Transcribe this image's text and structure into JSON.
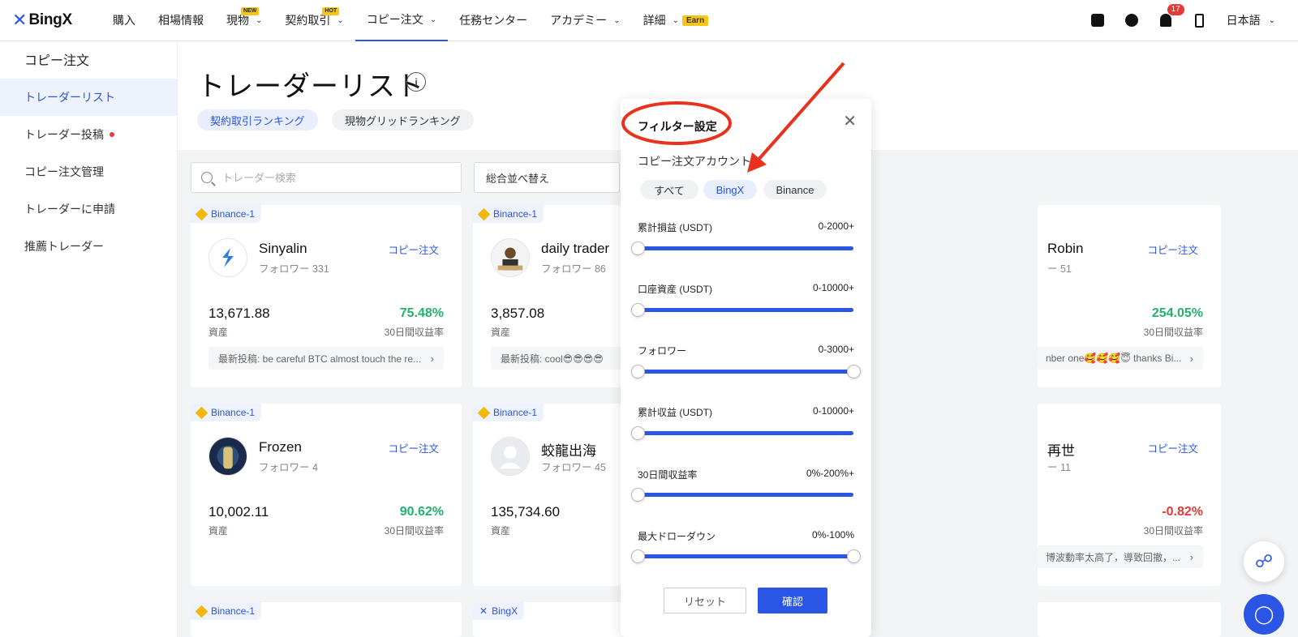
{
  "brand": {
    "name": "BingX",
    "color": "#2a55e5"
  },
  "nav": {
    "items": [
      {
        "label": "購入",
        "badge": "",
        "chevron": false
      },
      {
        "label": "相場情報",
        "badge": "",
        "chevron": false
      },
      {
        "label": "現物",
        "badge": "NEW",
        "chevron": true
      },
      {
        "label": "契約取引",
        "badge": "HOT",
        "chevron": true
      },
      {
        "label": "コピー注文",
        "badge": "",
        "chevron": true,
        "active": true
      },
      {
        "label": "任務センター",
        "badge": "",
        "chevron": false
      },
      {
        "label": "アカデミー",
        "badge": "",
        "chevron": true
      },
      {
        "label": "詳細",
        "badge": "",
        "chevron": true,
        "extra": "Earn"
      }
    ],
    "notification_count": "17",
    "language": "日本語"
  },
  "sidebar": {
    "title": "コピー注文",
    "items": [
      {
        "label": "トレーダーリスト",
        "active": true
      },
      {
        "label": "トレーダー投稿",
        "dot": true
      },
      {
        "label": "コピー注文管理"
      },
      {
        "label": "トレーダーに申請"
      },
      {
        "label": "推薦トレーダー"
      }
    ]
  },
  "page": {
    "title": "トレーダーリスト",
    "info_icon": "i",
    "tabs": [
      "契約取引ランキング",
      "現物グリッドランキング"
    ],
    "search_placeholder": "トレーダー検索",
    "sort_label": "総合並べ替え"
  },
  "cards": [
    {
      "source": "Binance-1",
      "source_icon": "binance",
      "name": "Sinyalin",
      "followers": "フォロワー 331",
      "copy": "コピー注文",
      "assets": "13,671.88",
      "assets_label": "資産",
      "roi": "75.48%",
      "roi_sign": "pos",
      "roi_label": "30日間収益率",
      "post": "最新投稿: be careful BTC almost touch the re..."
    },
    {
      "source": "Binance-1",
      "source_icon": "binance",
      "name": "daily trader",
      "followers": "フォロワー 86",
      "copy": "",
      "assets": "3,857.08",
      "assets_label": "資産",
      "roi": "",
      "roi_sign": "pos",
      "roi_label": "",
      "post": "最新投稿: cool😎😎😎😎"
    },
    {
      "source": "",
      "source_icon": "",
      "name": "Robin",
      "followers": "ー 51",
      "copy": "コピー注文",
      "assets": "",
      "assets_label": "",
      "roi": "254.05%",
      "roi_sign": "pos",
      "roi_label": "30日間収益率",
      "post": "nber one🥰🥰🥰😇 thanks Bi..."
    },
    {
      "source": "Binance-1",
      "source_icon": "binance",
      "name": "Frozen",
      "followers": "フォロワー 4",
      "copy": "コピー注文",
      "assets": "10,002.11",
      "assets_label": "資産",
      "roi": "90.62%",
      "roi_sign": "pos",
      "roi_label": "30日間収益率",
      "post": ""
    },
    {
      "source": "Binance-1",
      "source_icon": "binance",
      "name": "蛟龍出海",
      "followers": "フォロワー 45",
      "copy": "",
      "assets": "135,734.60",
      "assets_label": "資産",
      "roi": "",
      "roi_sign": "pos",
      "roi_label": "",
      "post": ""
    },
    {
      "source": "",
      "source_icon": "",
      "name": "再世",
      "followers": "ー 11",
      "copy": "コピー注文",
      "assets": "",
      "assets_label": "",
      "roi": "-0.82%",
      "roi_sign": "neg",
      "roi_label": "30日間収益率",
      "post": "博波動率太高了，導致回撤，..."
    },
    {
      "source": "Binance-1",
      "source_icon": "binance"
    },
    {
      "source": "BingX",
      "source_icon": "bingx"
    }
  ],
  "filter": {
    "title": "フィルター設定",
    "subtitle": "コピー注文アカウント",
    "account_tabs": [
      "すべて",
      "BingX",
      "Binance"
    ],
    "active_tab": "BingX",
    "rows": [
      {
        "label": "累計損益 (USDT)",
        "range": "0-2000+",
        "min": 0,
        "max": 0
      },
      {
        "label": "口座資産 (USDT)",
        "range": "0-10000+",
        "min": 0,
        "max": 0
      },
      {
        "label": "フォロワー",
        "range": "0-3000+",
        "min": 0,
        "max": 1
      },
      {
        "label": "累計収益 (USDT)",
        "range": "0-10000+",
        "min": 0,
        "max": 0
      },
      {
        "label": "30日間収益率",
        "range": "0%-200%+",
        "min": 0,
        "max": 0
      },
      {
        "label": "最大ドローダウン",
        "range": "0%-100%",
        "min": 0,
        "max": 1
      }
    ],
    "reset_label": "リセット",
    "confirm_label": "確認"
  },
  "colors": {
    "accent": "#2a55e5",
    "positive": "#21b36b",
    "negative": "#e53935",
    "annotation": "#e8321e"
  }
}
